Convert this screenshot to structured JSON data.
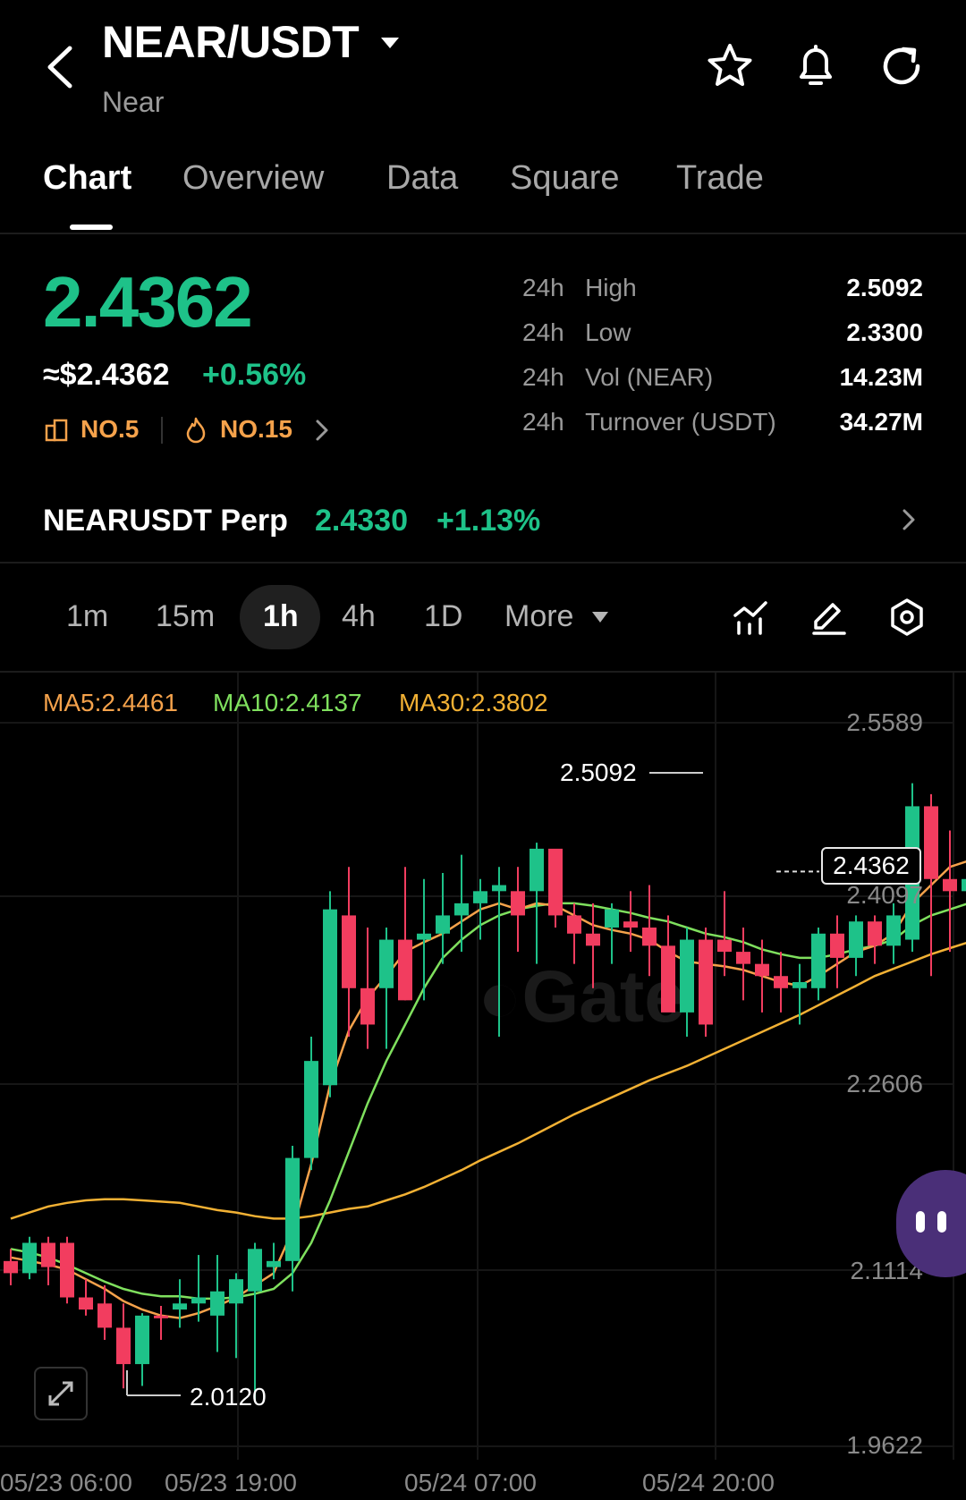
{
  "header": {
    "pair": "NEAR/USDT",
    "subtitle": "Near",
    "icons": [
      "back-icon",
      "star-icon",
      "bell-icon",
      "refresh-icon"
    ]
  },
  "tabs": [
    {
      "label": "Chart",
      "active": true
    },
    {
      "label": "Overview",
      "active": false
    },
    {
      "label": "Data",
      "active": false
    },
    {
      "label": "Square",
      "active": false
    },
    {
      "label": "Trade",
      "active": false
    }
  ],
  "price": {
    "last": "2.4362",
    "fiat": "≈$2.4362",
    "change": "+0.56%",
    "rank1": "NO.5",
    "rank2": "NO.15"
  },
  "stats": [
    {
      "period": "24h",
      "label": "High",
      "value": "2.5092"
    },
    {
      "period": "24h",
      "label": "Low",
      "value": "2.3300"
    },
    {
      "period": "24h",
      "label": "Vol (NEAR)",
      "value": "14.23M"
    },
    {
      "period": "24h",
      "label": "Turnover (USDT)",
      "value": "34.27M"
    }
  ],
  "perp": {
    "name": "NEARUSDT Perp",
    "price": "2.4330",
    "change": "+1.13%"
  },
  "timeframes": {
    "items": [
      "1m",
      "15m",
      "1h",
      "4h",
      "1D"
    ],
    "active": "1h",
    "more": "More"
  },
  "ma": {
    "ma5": "MA5:2.4461",
    "ma10": "MA10:2.4137",
    "ma30": "MA30:2.3802"
  },
  "colors": {
    "up": "#1ec289",
    "down": "#f23d5f",
    "ma5": "#f5a24b",
    "ma10": "#7fe05e",
    "ma30": "#f2b134"
  },
  "chart_data": {
    "type": "candlestick",
    "y_ticks": [
      "2.5589",
      "2.4097",
      "2.2606",
      "2.1114",
      "1.9622"
    ],
    "ylim": [
      1.9622,
      2.5589
    ],
    "x_ticks": [
      "05/23 06:00",
      "05/23 19:00",
      "05/24 07:00",
      "05/24 20:00"
    ],
    "current_price_label": "2.4362",
    "high_annotation": "2.5092",
    "low_annotation": "2.0120",
    "candles": [
      [
        2.115,
        2.125,
        2.095,
        2.105
      ],
      [
        2.105,
        2.135,
        2.1,
        2.13
      ],
      [
        2.13,
        2.135,
        2.095,
        2.11
      ],
      [
        2.13,
        2.135,
        2.08,
        2.085
      ],
      [
        2.085,
        2.1,
        2.07,
        2.075
      ],
      [
        2.08,
        2.095,
        2.05,
        2.06
      ],
      [
        2.06,
        2.08,
        2.01,
        2.03
      ],
      [
        2.03,
        2.072,
        2.012,
        2.07
      ],
      [
        2.07,
        2.078,
        2.05,
        2.068
      ],
      [
        2.075,
        2.1,
        2.06,
        2.08
      ],
      [
        2.08,
        2.12,
        2.065,
        2.085
      ],
      [
        2.07,
        2.12,
        2.04,
        2.09
      ],
      [
        2.08,
        2.105,
        2.035,
        2.1
      ],
      [
        2.09,
        2.13,
        2.0,
        2.125
      ],
      [
        2.11,
        2.13,
        2.1,
        2.115
      ],
      [
        2.115,
        2.21,
        2.09,
        2.2
      ],
      [
        2.2,
        2.3,
        2.19,
        2.28
      ],
      [
        2.26,
        2.42,
        2.25,
        2.405
      ],
      [
        2.4,
        2.44,
        2.3,
        2.34
      ],
      [
        2.34,
        2.39,
        2.29,
        2.31
      ],
      [
        2.34,
        2.39,
        2.29,
        2.38
      ],
      [
        2.38,
        2.44,
        2.33,
        2.33
      ],
      [
        2.38,
        2.43,
        2.33,
        2.385
      ],
      [
        2.385,
        2.435,
        2.36,
        2.4
      ],
      [
        2.4,
        2.45,
        2.37,
        2.41
      ],
      [
        2.41,
        2.43,
        2.38,
        2.42
      ],
      [
        2.42,
        2.44,
        2.3,
        2.425
      ],
      [
        2.42,
        2.44,
        2.37,
        2.4
      ],
      [
        2.42,
        2.46,
        2.36,
        2.455
      ],
      [
        2.455,
        2.44,
        2.39,
        2.4
      ],
      [
        2.4,
        2.41,
        2.36,
        2.385
      ],
      [
        2.385,
        2.41,
        2.34,
        2.375
      ],
      [
        2.39,
        2.41,
        2.36,
        2.405
      ],
      [
        2.395,
        2.42,
        2.37,
        2.39
      ],
      [
        2.39,
        2.425,
        2.35,
        2.375
      ],
      [
        2.375,
        2.4,
        2.34,
        2.32
      ],
      [
        2.32,
        2.39,
        2.3,
        2.38
      ],
      [
        2.38,
        2.39,
        2.3,
        2.31
      ],
      [
        2.38,
        2.42,
        2.35,
        2.37
      ],
      [
        2.37,
        2.39,
        2.33,
        2.36
      ],
      [
        2.36,
        2.38,
        2.32,
        2.35
      ],
      [
        2.35,
        2.37,
        2.32,
        2.34
      ],
      [
        2.34,
        2.36,
        2.31,
        2.345
      ],
      [
        2.34,
        2.39,
        2.33,
        2.385
      ],
      [
        2.385,
        2.4,
        2.34,
        2.365
      ],
      [
        2.365,
        2.4,
        2.35,
        2.395
      ],
      [
        2.395,
        2.4,
        2.36,
        2.375
      ],
      [
        2.375,
        2.41,
        2.36,
        2.4
      ],
      [
        2.38,
        2.509,
        2.37,
        2.49
      ],
      [
        2.49,
        2.5,
        2.35,
        2.43
      ],
      [
        2.43,
        2.47,
        2.37,
        2.42
      ],
      [
        2.42,
        2.46,
        2.4,
        2.43
      ],
      [
        2.43,
        2.46,
        2.4,
        2.438
      ]
    ],
    "series": [
      {
        "name": "MA5",
        "values": [
          2.118,
          2.115,
          2.112,
          2.108,
          2.1,
          2.092,
          2.082,
          2.075,
          2.07,
          2.068,
          2.072,
          2.078,
          2.085,
          2.095,
          2.105,
          2.14,
          2.195,
          2.26,
          2.305,
          2.332,
          2.35,
          2.37,
          2.378,
          2.385,
          2.395,
          2.405,
          2.41,
          2.405,
          2.41,
          2.408,
          2.4,
          2.392,
          2.388,
          2.385,
          2.38,
          2.37,
          2.362,
          2.36,
          2.358,
          2.355,
          2.35,
          2.345,
          2.342,
          2.35,
          2.36,
          2.37,
          2.375,
          2.385,
          2.41,
          2.425,
          2.44,
          2.445,
          2.446
        ]
      },
      {
        "name": "MA10",
        "values": [
          2.125,
          2.122,
          2.118,
          2.112,
          2.105,
          2.098,
          2.092,
          2.088,
          2.086,
          2.086,
          2.084,
          2.084,
          2.085,
          2.088,
          2.092,
          2.105,
          2.13,
          2.165,
          2.205,
          2.245,
          2.28,
          2.31,
          2.34,
          2.365,
          2.38,
          2.392,
          2.4,
          2.405,
          2.408,
          2.41,
          2.41,
          2.408,
          2.405,
          2.402,
          2.398,
          2.395,
          2.39,
          2.385,
          2.382,
          2.378,
          2.372,
          2.368,
          2.365,
          2.365,
          2.368,
          2.372,
          2.375,
          2.38,
          2.392,
          2.4,
          2.405,
          2.41,
          2.414
        ]
      },
      {
        "name": "MA30",
        "values": [
          2.15,
          2.155,
          2.16,
          2.163,
          2.165,
          2.166,
          2.166,
          2.165,
          2.164,
          2.163,
          2.16,
          2.157,
          2.155,
          2.152,
          2.15,
          2.15,
          2.152,
          2.155,
          2.158,
          2.16,
          2.165,
          2.17,
          2.176,
          2.183,
          2.19,
          2.198,
          2.205,
          2.212,
          2.22,
          2.228,
          2.236,
          2.243,
          2.25,
          2.257,
          2.264,
          2.27,
          2.276,
          2.283,
          2.29,
          2.297,
          2.304,
          2.311,
          2.318,
          2.326,
          2.334,
          2.342,
          2.35,
          2.356,
          2.362,
          2.368,
          2.373,
          2.378,
          2.38
        ]
      }
    ]
  }
}
